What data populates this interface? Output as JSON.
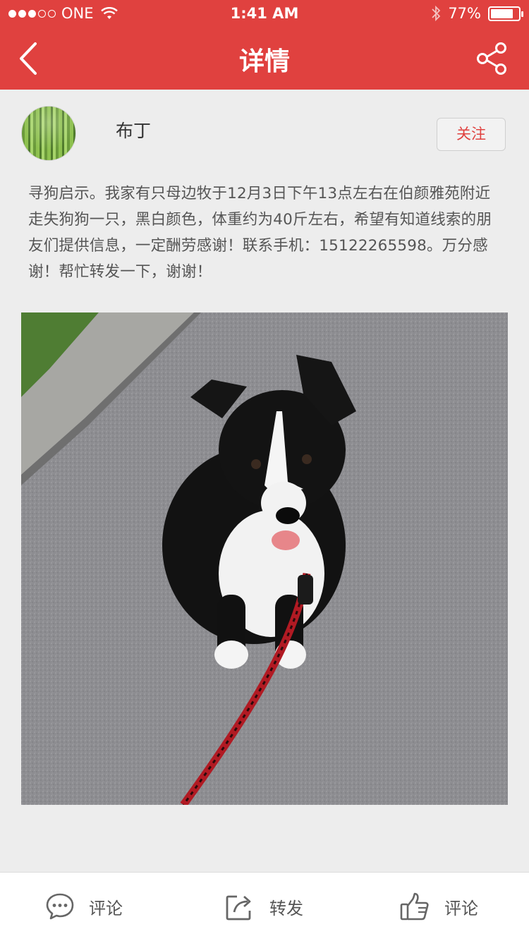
{
  "status_bar": {
    "carrier": "ONE",
    "time": "1:41 AM",
    "battery": "77%",
    "signal_bars_filled": 3,
    "signal_bars_total": 5
  },
  "nav": {
    "title": "详情",
    "back_icon": "chevron-left-icon",
    "share_icon": "share-icon"
  },
  "author": {
    "name": "布丁",
    "follow_label": "关注"
  },
  "post": {
    "text": "寻狗启示。我家有只母边牧于12月3日下午13点左右在伯颜雅苑附近走失狗狗一只，黑白颜色，体重约为40斤左右，希望有知道线索的朋友们提供信息，一定酬劳感谢！联系手机：15122265598。万分感谢！帮忙转发一下，谢谢！"
  },
  "actions": [
    {
      "icon": "comment-icon",
      "label": "评论"
    },
    {
      "icon": "forward-icon",
      "label": "转发"
    },
    {
      "icon": "thumbs-up-icon",
      "label": "评论"
    }
  ],
  "colors": {
    "brand_red": "#e0413f",
    "background": "#ededed",
    "text": "#555555"
  }
}
